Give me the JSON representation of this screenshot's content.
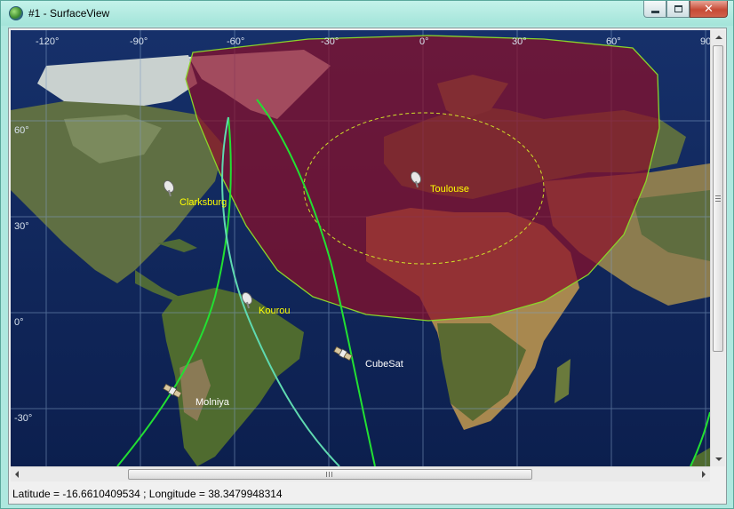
{
  "window": {
    "title": "#1 - SurfaceView",
    "icon": "globe-icon",
    "buttons": {
      "minimize": "minimize-icon",
      "maximize": "maximize-icon",
      "close": "close-icon"
    }
  },
  "map": {
    "longitude_labels": [
      "-120°",
      "-90°",
      "-60°",
      "-30°",
      "0°",
      "30°",
      "60°",
      "90°"
    ],
    "latitude_labels": [
      "60°",
      "30°",
      "0°",
      "-30°"
    ],
    "coverage_color": "#8b0f2a",
    "coverage_outline_color": "#8ad42a",
    "track_color_bright": "#22e032",
    "track_color_cyan": "#5fd9b0",
    "ground_stations": [
      {
        "name": "Clarksburg",
        "icon": "ground-station-antenna-icon",
        "label_color": "#ffff00"
      },
      {
        "name": "Toulouse",
        "icon": "ground-station-antenna-icon",
        "label_color": "#ffff00"
      },
      {
        "name": "Kourou",
        "icon": "ground-station-antenna-icon",
        "label_color": "#ffff00"
      }
    ],
    "satellites": [
      {
        "name": "CubeSat",
        "icon": "satellite-icon",
        "label_color": "#ffffff"
      },
      {
        "name": "Molniya",
        "icon": "satellite-icon",
        "label_color": "#ffffff"
      }
    ]
  },
  "status_bar": {
    "text": "Latitude = -16.6610409534 ; Longitude = 38.3479948314"
  }
}
